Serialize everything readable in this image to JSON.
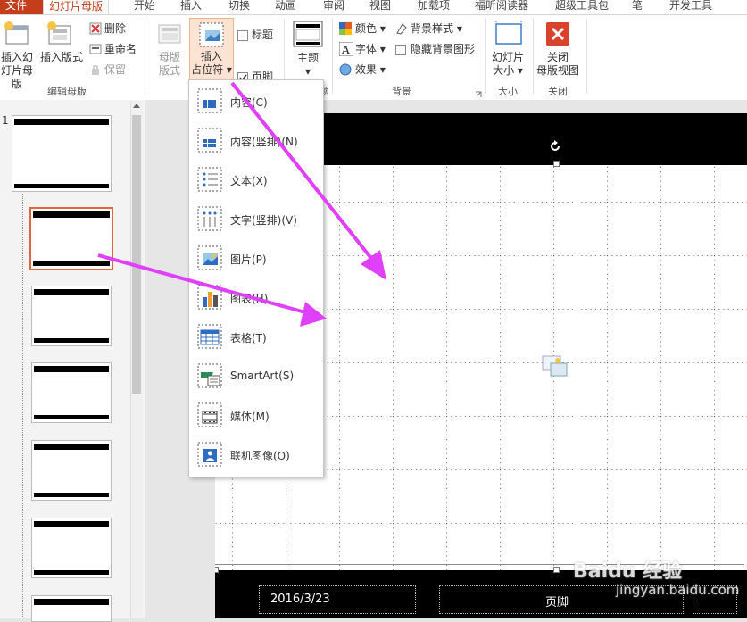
{
  "tabs": [
    "文件",
    "幻灯片母版",
    "开始",
    "插入",
    "切换",
    "动画",
    "审阅",
    "视图",
    "加载项",
    "福昕阅读器",
    "超级工具包",
    "笔",
    "开发工具"
  ],
  "ribbon": {
    "insert_slide_master": "插入幻\n灯片母版",
    "insert_layout": "插入版式",
    "delete": "删除",
    "rename": "重命名",
    "preserve": "保留",
    "group_edit_master": "编辑母版",
    "master_layout": "母版\n版式",
    "insert_placeholder": "插入\n占位符 ▾",
    "title_label": "标题",
    "footer_label": "页脚",
    "theme": "主题\n▾",
    "colors": "颜色 ▾",
    "fonts": "字体 ▾",
    "effects": "效果 ▾",
    "bg_styles": "背景样式 ▾",
    "hide_bg": "隐藏背景图形",
    "group_background": "背景",
    "slide_size": "幻灯片\n大小 ▾",
    "group_size": "大小",
    "close_master": "关闭\n母版视图",
    "group_close": "关闭",
    "partial_group": "题"
  },
  "menu": [
    {
      "label": "内容(C)",
      "icon": "content-icon"
    },
    {
      "label": "内容(竖排)(N)",
      "icon": "content-vertical-icon"
    },
    {
      "label": "文本(X)",
      "icon": "text-icon"
    },
    {
      "label": "文字(竖排)(V)",
      "icon": "text-vertical-icon"
    },
    {
      "label": "图片(P)",
      "icon": "picture-icon"
    },
    {
      "label": "图表(H)",
      "icon": "chart-icon"
    },
    {
      "label": "表格(T)",
      "icon": "table-icon"
    },
    {
      "label": "SmartArt(S)",
      "icon": "smartart-icon"
    },
    {
      "label": "媒体(M)",
      "icon": "media-icon"
    },
    {
      "label": "联机图像(O)",
      "icon": "online-image-icon"
    }
  ],
  "thumbs": {
    "first_number": "1"
  },
  "slide": {
    "date": "2016/3/23",
    "footer": "页脚"
  },
  "watermark": {
    "brand": "Baidu 经验",
    "url": "jingyan.baidu.com"
  },
  "colors": {
    "accent": "#c43e1c",
    "arrow": "#e040fb",
    "highlight": "#fde3d3"
  }
}
